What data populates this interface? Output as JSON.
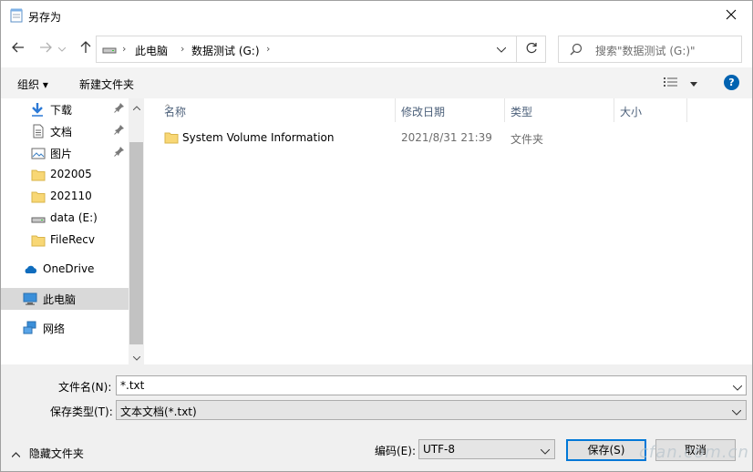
{
  "window": {
    "title": "另存为"
  },
  "address": {
    "crumbs": [
      "此电脑",
      "数据测试 (G:)"
    ]
  },
  "search": {
    "placeholder": "搜索\"数据测试 (G:)\""
  },
  "commands": {
    "organize": "组织 ▾",
    "new_folder": "新建文件夹"
  },
  "nav_pane": {
    "items": [
      {
        "label": "下载",
        "icon": "download-icon",
        "pinned": true
      },
      {
        "label": "文档",
        "icon": "document-icon",
        "pinned": true
      },
      {
        "label": "图片",
        "icon": "picture-icon",
        "pinned": true
      },
      {
        "label": "202005",
        "icon": "folder-icon",
        "pinned": false
      },
      {
        "label": "202110",
        "icon": "folder-icon",
        "pinned": false
      },
      {
        "label": "data (E:)",
        "icon": "drive-icon",
        "pinned": false
      },
      {
        "label": "FileRecv",
        "icon": "folder-icon",
        "pinned": false
      },
      {
        "label": "OneDrive",
        "icon": "cloud-icon",
        "pinned": false
      },
      {
        "label": "此电脑",
        "icon": "computer-icon",
        "pinned": false,
        "selected": true
      },
      {
        "label": "网络",
        "icon": "network-icon",
        "pinned": false
      }
    ]
  },
  "file_list": {
    "columns": [
      "名称",
      "修改日期",
      "类型",
      "大小"
    ],
    "rows": [
      {
        "name": "System Volume Information",
        "modified": "2021/8/31 21:39",
        "type": "文件夹",
        "size": ""
      }
    ]
  },
  "form": {
    "filename_label": "文件名(N):",
    "filename_value": "*.txt",
    "filetype_label": "保存类型(T):",
    "filetype_value": "文本文档(*.txt)",
    "encoding_label": "编码(E):",
    "encoding_value": "UTF-8",
    "hide_folders": "隐藏文件夹",
    "save_button": "保存(S)",
    "cancel_button": "取消"
  },
  "watermark": "cfan.com.cn",
  "colors": {
    "accent": "#0078d7",
    "help": "#0063b1",
    "selection": "#d9d9d9",
    "folder": "#f8d775"
  }
}
